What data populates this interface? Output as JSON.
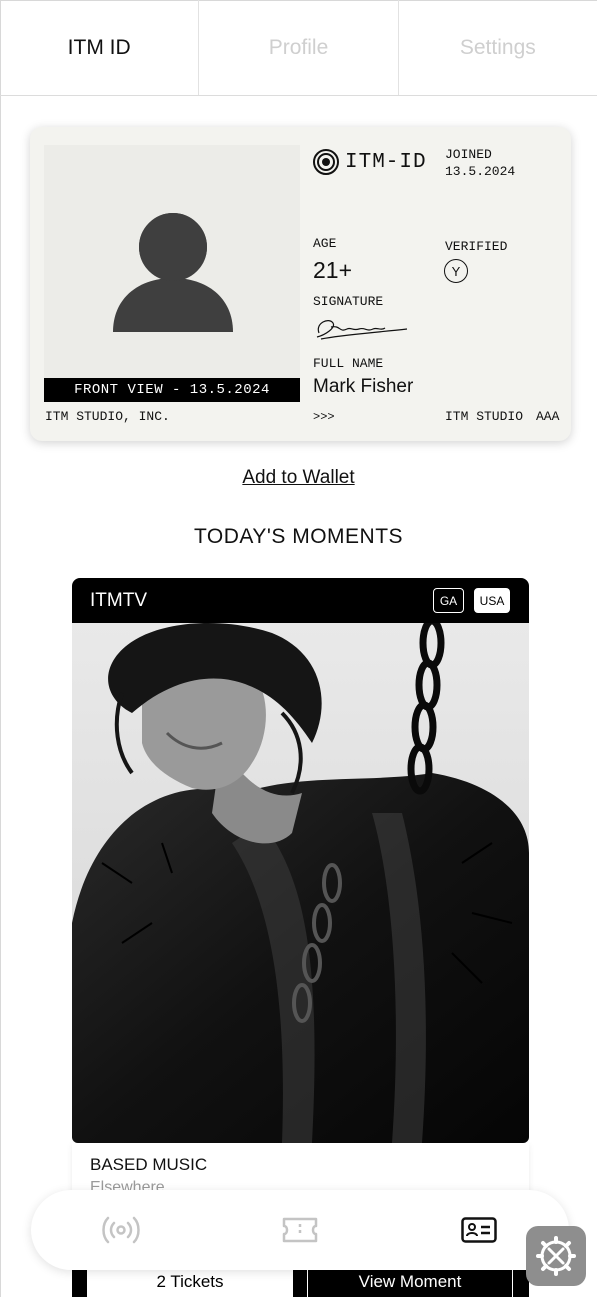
{
  "tabs": [
    {
      "label": "ITM ID",
      "active": true
    },
    {
      "label": "Profile",
      "active": false
    },
    {
      "label": "Settings",
      "active": false
    }
  ],
  "id_card": {
    "photo_caption": "FRONT VIEW - 13.5.2024",
    "issuer": "ITM STUDIO, INC.",
    "brand": "ITM-ID",
    "joined_label": "JOINED",
    "joined_date": "13.5.2024",
    "age_label": "AGE",
    "age_value": "21+",
    "verified_label": "VERIFIED",
    "verified_badge": "Y",
    "signature_label": "SIGNATURE",
    "name_label": "FULL NAME",
    "full_name": "Mark Fisher",
    "chevrons": ">>>",
    "studio": "ITM STUDIO",
    "grade": "AAA"
  },
  "add_wallet_label": "Add to Wallet",
  "moments_title": "TODAY'S MOMENTS",
  "moment": {
    "brand": "ITMTV",
    "chip_ga": "GA",
    "chip_usa": "USA",
    "title": "BASED MUSIC",
    "subtitle": "Elsewhere",
    "tickets_label": "2 Tickets",
    "view_label": "View Moment"
  },
  "nav": {
    "items": [
      "broadcast-icon",
      "ticket-icon",
      "id-card-icon"
    ],
    "active": "id-card-icon"
  },
  "colors": {
    "card_bg": "#f3f3ef",
    "accent": "#000000",
    "inactive_tab": "#cfcfcf"
  }
}
